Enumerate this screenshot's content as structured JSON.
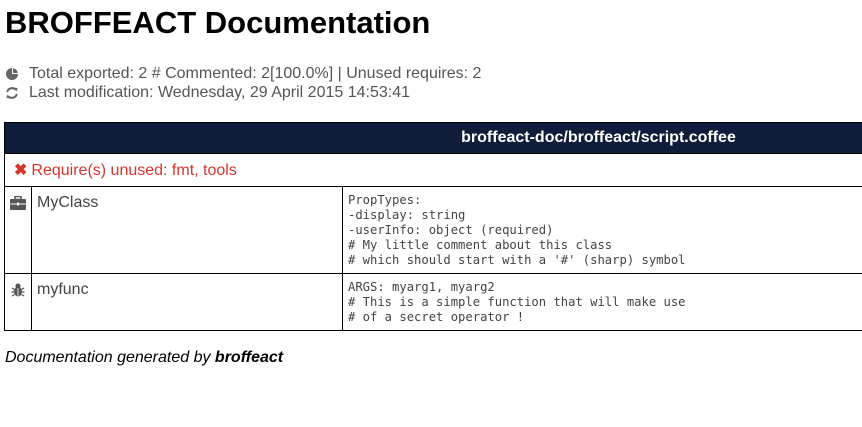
{
  "header": {
    "title": "BROFFEACT Documentation"
  },
  "stats": {
    "exported_line": "Total exported: 2 # Commented: 2[100.0%] | Unused requires: 2",
    "modification_line": "Last modification: Wednesday, 29 April 2015 14:53:41"
  },
  "file": {
    "path": "broffeact-doc/broffeact/script.coffee",
    "warning_icon": "✖",
    "warning": "Require(s) unused: fmt, tools"
  },
  "entries": [
    {
      "icon": "briefcase-icon",
      "name": "MyClass",
      "doc": "PropTypes:\n-display: string\n-userInfo: object (required)\n# My little comment about this class\n# which should start with a '#' (sharp) symbol"
    },
    {
      "icon": "bug-icon",
      "name": "myfunc",
      "doc": "ARGS: myarg1, myarg2\n# This is a simple function that will make use\n# of a secret operator !"
    }
  ],
  "footer": {
    "prefix": "Documentation generated by ",
    "brand": "broffeact"
  },
  "colors": {
    "header_bg": "#0f1d3a",
    "warning": "#d9342b",
    "muted_text": "#555555"
  }
}
